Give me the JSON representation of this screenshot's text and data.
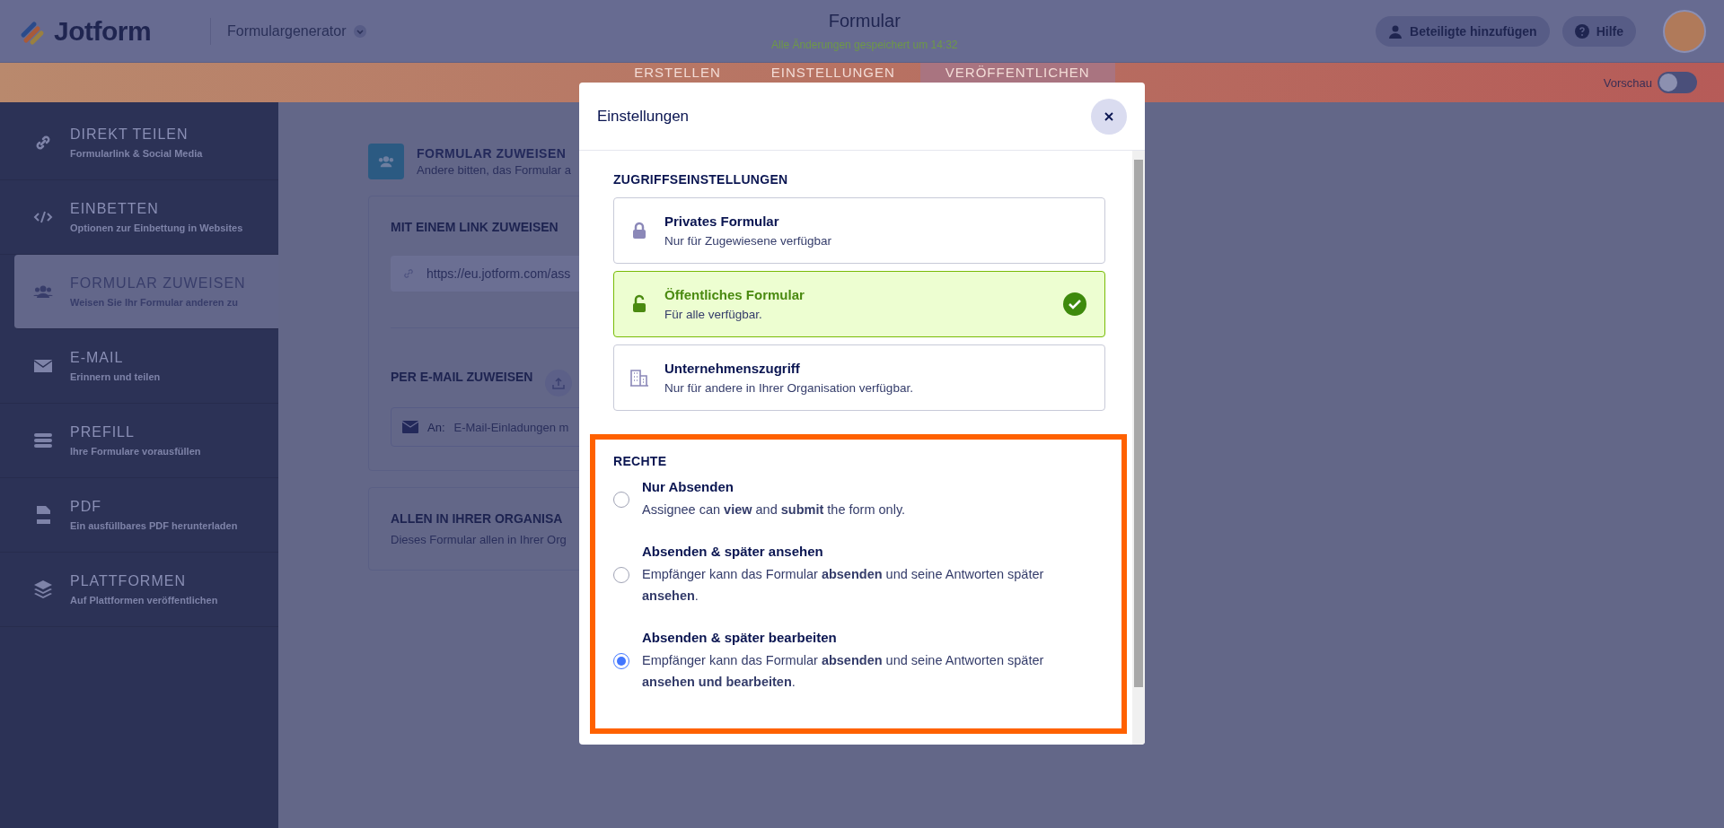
{
  "header": {
    "logo": "Jotform",
    "builder_menu": "Formulargenerator",
    "title": "Formular",
    "save_status": "Alle Änderungen gespeichert um 14:32",
    "buttons": [
      {
        "label": "Beteiligte hinzufügen",
        "kind": "person"
      },
      {
        "label": "Hilfe",
        "kind": "help"
      }
    ]
  },
  "tabs": [
    {
      "label": "ERSTELLEN",
      "selected": false
    },
    {
      "label": "EINSTELLUNGEN",
      "selected": false
    },
    {
      "label": "VERÖFFENTLICHEN",
      "selected": true
    }
  ],
  "preview_toggle": {
    "label": "Vorschau",
    "on": false
  },
  "sidebar": {
    "items": [
      {
        "title": "DIREKT TEILEN",
        "subtitle": "Formularlink & Social Media",
        "kind": "link",
        "selected": false
      },
      {
        "title": "EINBETTEN",
        "subtitle": "Optionen zur Einbettung in Websites",
        "kind": "code",
        "selected": false
      },
      {
        "title": "FORMULAR ZUWEISEN",
        "subtitle": "Weisen Sie Ihr Formular anderen zu",
        "kind": "users",
        "selected": true
      },
      {
        "title": "E-MAIL",
        "subtitle": "Erinnern und teilen",
        "kind": "mail",
        "selected": false
      },
      {
        "title": "PREFILL",
        "subtitle": "Ihre Formulare vorausfüllen",
        "kind": "prefill",
        "selected": false
      },
      {
        "title": "PDF",
        "subtitle": "Ein ausfüllbares PDF herunterladen",
        "kind": "pdf",
        "selected": false
      },
      {
        "title": "PLATTFORMEN",
        "subtitle": "Auf Plattformen veröffentlichen",
        "kind": "layers",
        "selected": false
      }
    ]
  },
  "main": {
    "title": "FORMULAR ZUWEISEN",
    "subtitle": "Andere bitten, das Formular a",
    "link_section": {
      "title": "MIT EINEM LINK ZUWEISEN",
      "url": "https://eu.jotform.com/ass"
    },
    "email_section": {
      "title": "PER E-MAIL ZUWEISEN",
      "to_label": "An:",
      "placeholder": "E-Mail-Einladungen m"
    },
    "org_section": {
      "title": "ALLEN IN IHRER ORGANISA",
      "subtitle": "Dieses Formular allen in Ihrer Org"
    }
  },
  "dialog": {
    "title": "Einstellungen",
    "access": {
      "heading": "ZUGRIFFSEINSTELLUNGEN",
      "options": [
        {
          "title": "Privates Formular",
          "description": "Nur für Zugewiesene verfügbar",
          "kind": "lock",
          "selected": false
        },
        {
          "title": "Öffentliches Formular",
          "description": "Für alle verfügbar.",
          "kind": "unlock",
          "selected": true
        },
        {
          "title": "Unternehmenszugriff",
          "description": "Nur für andere in Ihrer Organisation verfügbar.",
          "kind": "building",
          "selected": false
        }
      ]
    },
    "permissions": {
      "heading": "RECHTE",
      "options": [
        {
          "title": "Nur Absenden",
          "description": "Assignee can **view** and **submit** the form only.",
          "selected": false
        },
        {
          "title": "Absenden & später ansehen",
          "description": "Empfänger kann das Formular **absenden** und seine Antworten später **ansehen**.",
          "selected": false
        },
        {
          "title": "Absenden & später bearbeiten",
          "description": "Empfänger kann das Formular **absenden** und seine Antworten später **ansehen und bearbeiten**.",
          "selected": true
        }
      ]
    }
  }
}
